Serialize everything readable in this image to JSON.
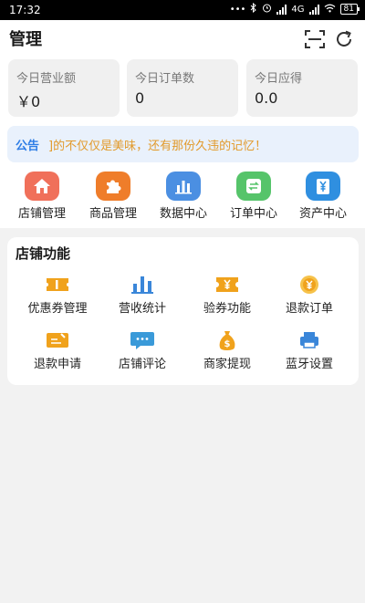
{
  "status_bar": {
    "time": "17:32",
    "dots": "•••",
    "network": "4G",
    "battery": "81"
  },
  "header": {
    "title": "管理",
    "scan_icon": "scan-icon",
    "refresh_icon": "refresh-icon"
  },
  "stats": [
    {
      "label": "今日营业额",
      "value": "￥0"
    },
    {
      "label": "今日订单数",
      "value": "0"
    },
    {
      "label": "今日应得",
      "value": "0.0"
    }
  ],
  "notice": {
    "tag": "公告",
    "text": "]的不仅仅是美味，还有那份久违的记忆！"
  },
  "quick_menu": [
    {
      "label": "店铺管理",
      "icon": "home-icon",
      "color": "#f0705a"
    },
    {
      "label": "商品管理",
      "icon": "puzzle-icon",
      "color": "#ef7d2a"
    },
    {
      "label": "数据中心",
      "icon": "bar-chart-icon",
      "color": "#4b8fe2"
    },
    {
      "label": "订单中心",
      "icon": "order-icon",
      "color": "#56c46a"
    },
    {
      "label": "资产中心",
      "icon": "yen-wallet-icon",
      "color": "#2f8fe0"
    }
  ],
  "store_functions": {
    "title": "店铺功能",
    "items": [
      {
        "label": "优惠券管理",
        "icon": "coupon-icon"
      },
      {
        "label": "营收统计",
        "icon": "bar-chart-icon"
      },
      {
        "label": "验券功能",
        "icon": "ticket-verify-icon"
      },
      {
        "label": "退款订单",
        "icon": "refund-coin-icon"
      },
      {
        "label": "退款申请",
        "icon": "refund-form-icon"
      },
      {
        "label": "店铺评论",
        "icon": "comment-icon"
      },
      {
        "label": "商家提现",
        "icon": "money-bag-icon"
      },
      {
        "label": "蓝牙设置",
        "icon": "printer-icon"
      }
    ]
  },
  "colors": {
    "accent_blue": "#2f7ee6",
    "notice_text": "#e29a2b",
    "notice_bg": "#e9f1fc",
    "feature_orange": "#f0a21c",
    "feature_blue": "#3a86d9"
  }
}
